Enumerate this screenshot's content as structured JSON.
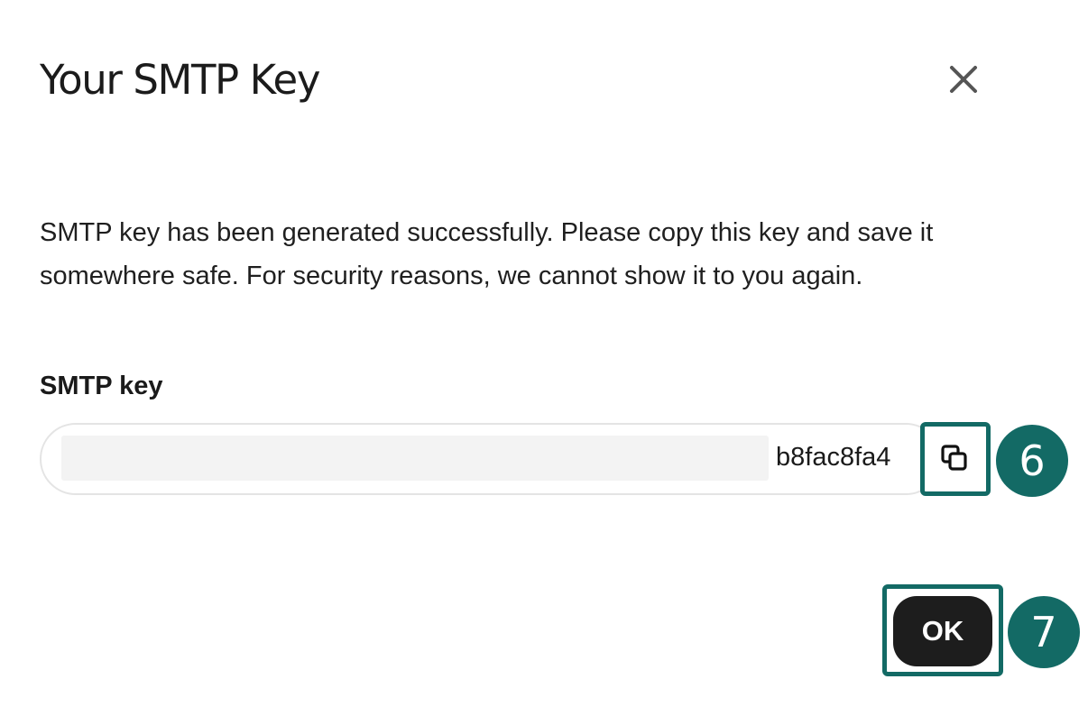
{
  "dialog": {
    "title": "Your SMTP Key",
    "close_icon": "close-icon",
    "message": "SMTP key has been generated successfully. Please copy this key and save it somewhere safe. For security reasons, we cannot show it to you again.",
    "field_label": "SMTP key",
    "key_visible_text": "b8fac8fa4",
    "copy_icon": "copy-icon",
    "ok_label": "OK"
  },
  "annotations": {
    "step_copy": "6",
    "step_ok": "7",
    "highlight_color": "#136a65"
  }
}
